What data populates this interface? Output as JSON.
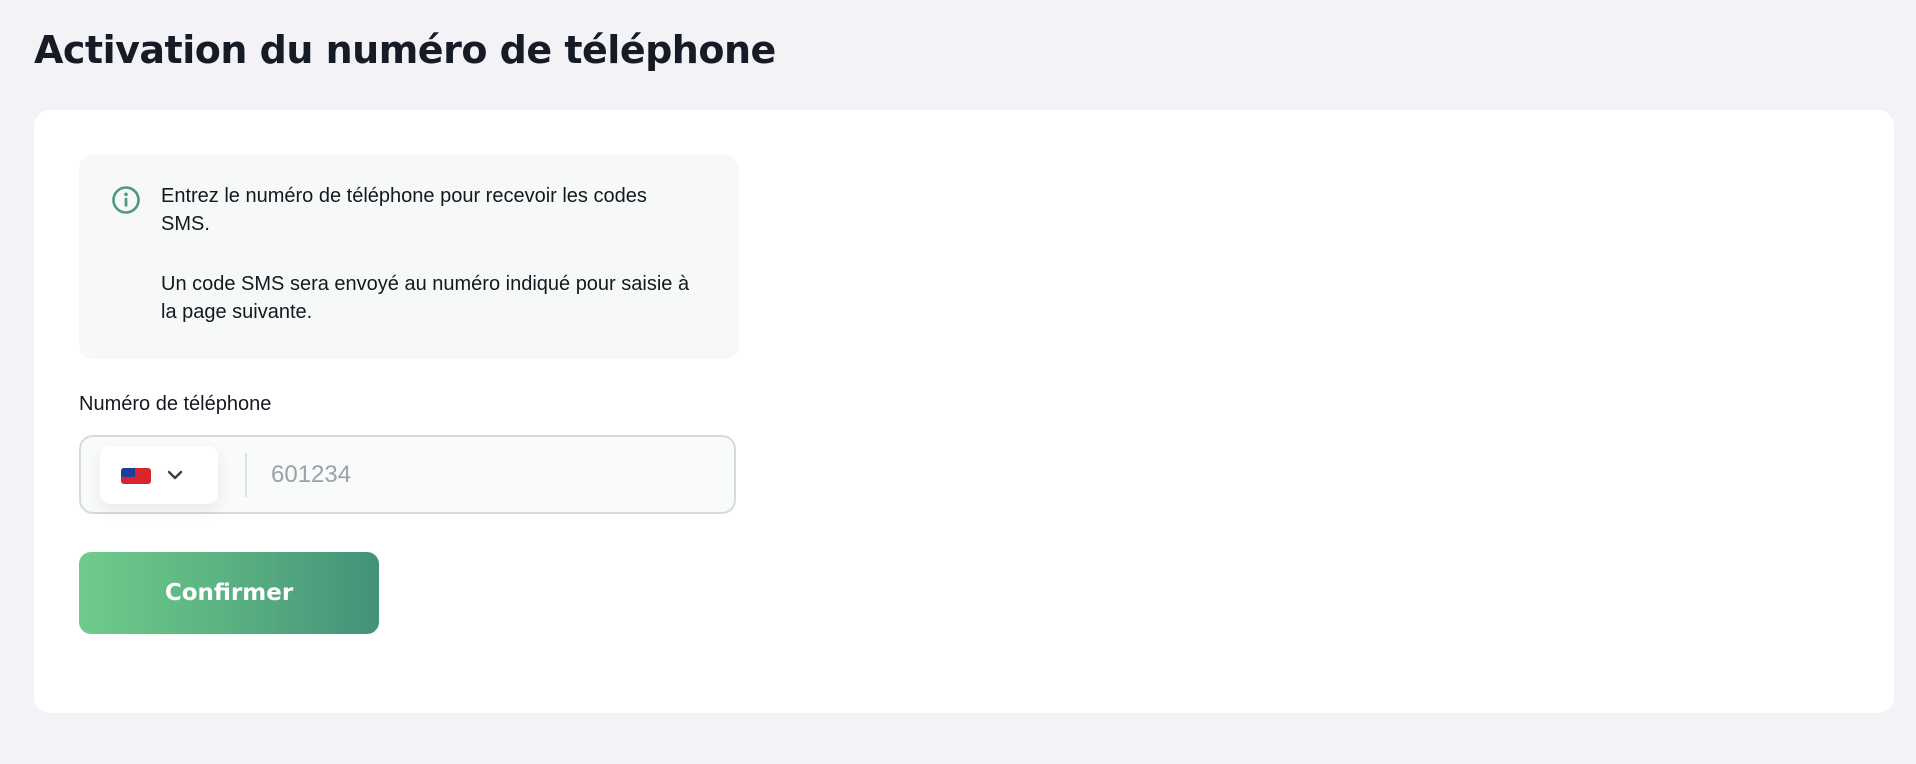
{
  "page": {
    "title": "Activation du numéro de téléphone"
  },
  "info": {
    "icon": "info-circle-icon",
    "line1": "Entrez le numéro de téléphone pour recevoir les codes SMS.",
    "line2": "Un code SMS sera envoyé au numéro indiqué pour saisie à la page suivante."
  },
  "phone": {
    "label": "Numéro de téléphone",
    "country_flag_icon": "flag-icon",
    "dropdown_icon": "chevron-down-icon",
    "value": "",
    "placeholder": "601234"
  },
  "actions": {
    "confirm_label": "Confirmer"
  },
  "colors": {
    "page_background": "#f3f3f7",
    "card_background": "#ffffff",
    "info_background": "#f7f9f9",
    "accent_green": "#4f9a7c",
    "button_gradient_start": "#6fcb8c",
    "button_gradient_end": "#43927a"
  }
}
